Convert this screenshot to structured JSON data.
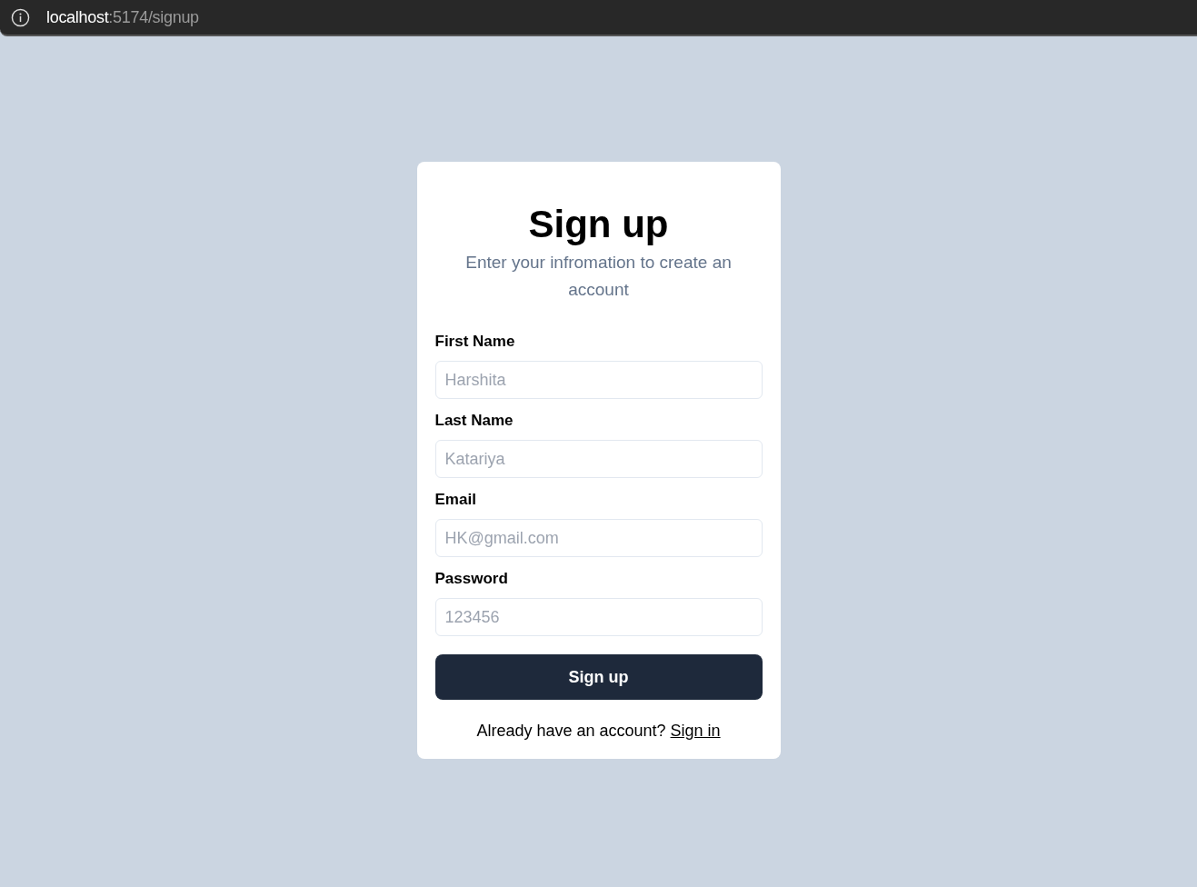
{
  "address_bar": {
    "host": "localhost",
    "path": ":5174/signup"
  },
  "card": {
    "title": "Sign up",
    "subtitle": "Enter your infromation to create an account",
    "fields": [
      {
        "label": "First Name",
        "placeholder": "Harshita"
      },
      {
        "label": "Last Name",
        "placeholder": "Katariya"
      },
      {
        "label": "Email",
        "placeholder": "HK@gmail.com"
      },
      {
        "label": "Password",
        "placeholder": "123456"
      }
    ],
    "button": "Sign up",
    "footer": {
      "text": "Already have an account?",
      "link": "Sign in"
    }
  }
}
